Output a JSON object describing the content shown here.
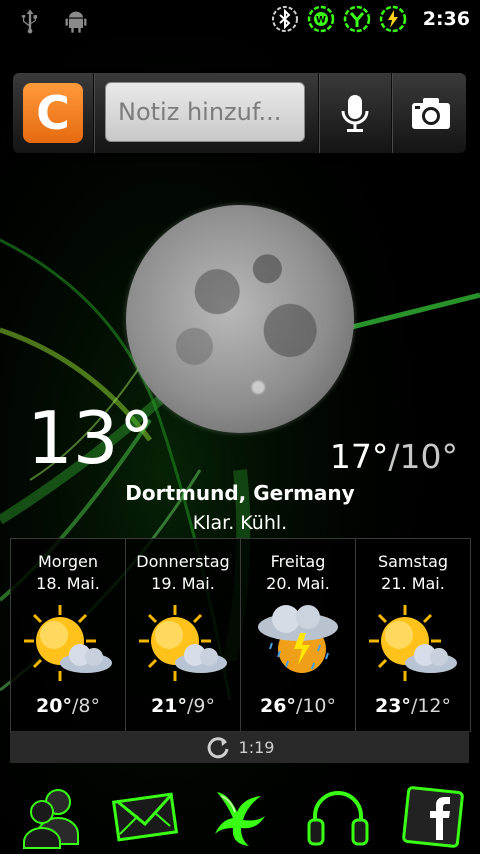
{
  "status_bar": {
    "time": "2:36",
    "left_icons": [
      "usb-icon",
      "android-debug-icon"
    ],
    "right_icons": [
      "bluetooth-icon",
      "wifi-icon",
      "signal-icon",
      "battery-charging-icon"
    ]
  },
  "search_widget": {
    "logo_letter": "C",
    "note_placeholder": "Notiz hinzuf...",
    "mic_icon": "microphone-icon",
    "camera_icon": "camera-icon"
  },
  "weather": {
    "current_temp": "13°",
    "high": "17°",
    "low": "/10°",
    "city": "Dortmund, Germany",
    "condition": "Klar. Kühl.",
    "forecast": [
      {
        "day": "Morgen",
        "date": "18. Mai.",
        "high": "20°",
        "low": "/8°",
        "icon": "sun-cloud-icon"
      },
      {
        "day": "Donnerstag",
        "date": "19. Mai.",
        "high": "21°",
        "low": "/9°",
        "icon": "sun-cloud-icon"
      },
      {
        "day": "Freitag",
        "date": "20. Mai.",
        "high": "26°",
        "low": "/10°",
        "icon": "thunder-rain-icon"
      },
      {
        "day": "Samstag",
        "date": "21. Mai.",
        "high": "23°",
        "low": "/12°",
        "icon": "sun-cloud-icon"
      }
    ],
    "last_update": "1:19"
  },
  "dock": [
    "contacts-icon",
    "messaging-icon",
    "app-drawer-icon",
    "music-icon",
    "facebook-icon"
  ],
  "colors": {
    "accent_green": "#39ff14",
    "logo_orange": "#f07a1e"
  }
}
